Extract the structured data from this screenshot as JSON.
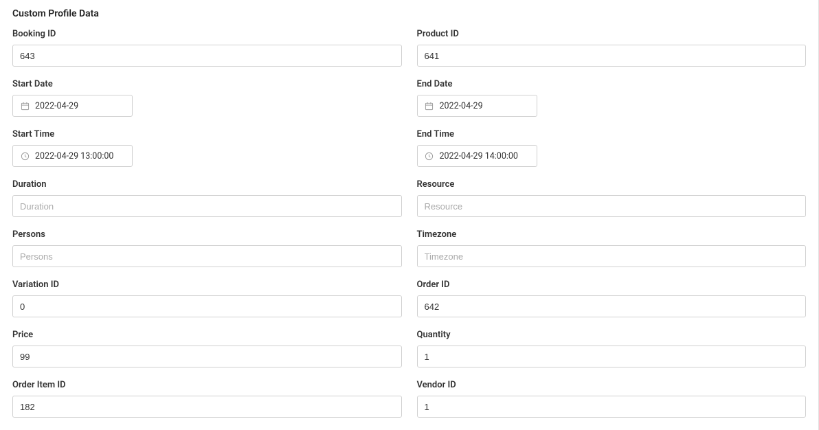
{
  "section_title": "Custom Profile Data",
  "fields": {
    "booking_id": {
      "label": "Booking ID",
      "value": "643",
      "placeholder": ""
    },
    "product_id": {
      "label": "Product ID",
      "value": "641",
      "placeholder": ""
    },
    "start_date": {
      "label": "Start Date",
      "value": "2022-04-29"
    },
    "end_date": {
      "label": "End Date",
      "value": "2022-04-29"
    },
    "start_time": {
      "label": "Start Time",
      "value": "2022-04-29 13:00:00"
    },
    "end_time": {
      "label": "End Time",
      "value": "2022-04-29 14:00:00"
    },
    "duration": {
      "label": "Duration",
      "value": "",
      "placeholder": "Duration"
    },
    "resource": {
      "label": "Resource",
      "value": "",
      "placeholder": "Resource"
    },
    "persons": {
      "label": "Persons",
      "value": "",
      "placeholder": "Persons"
    },
    "timezone": {
      "label": "Timezone",
      "value": "",
      "placeholder": "Timezone"
    },
    "variation_id": {
      "label": "Variation ID",
      "value": "0",
      "placeholder": ""
    },
    "order_id": {
      "label": "Order ID",
      "value": "642",
      "placeholder": ""
    },
    "price": {
      "label": "Price",
      "value": "99",
      "placeholder": ""
    },
    "quantity": {
      "label": "Quantity",
      "value": "1",
      "placeholder": ""
    },
    "order_item_id": {
      "label": "Order Item ID",
      "value": "182",
      "placeholder": ""
    },
    "vendor_id": {
      "label": "Vendor ID",
      "value": "1",
      "placeholder": ""
    }
  }
}
